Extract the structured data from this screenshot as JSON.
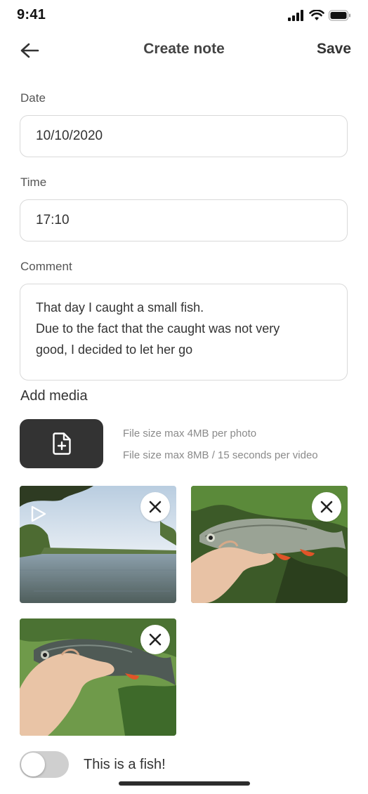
{
  "status_bar": {
    "time": "9:41"
  },
  "header": {
    "title": "Create note",
    "save_label": "Save"
  },
  "form": {
    "date": {
      "label": "Date",
      "value": "10/10/2020"
    },
    "time": {
      "label": "Time",
      "value": "17:10"
    },
    "comment": {
      "label": "Comment",
      "lines": [
        "That day I caught a small fish.",
        "Due to the fact that the caught was not very",
        "good, I decided to let her go"
      ]
    }
  },
  "media": {
    "title": "Add media",
    "hints": [
      "File size max 4MB per photo",
      "File size max 8MB / 15 seconds per video"
    ],
    "items": [
      {
        "type": "video",
        "subject": "lake"
      },
      {
        "type": "photo",
        "subject": "fish"
      },
      {
        "type": "photo",
        "subject": "fish"
      }
    ]
  },
  "toggle": {
    "label": "This is a fish!",
    "on": false
  },
  "colors": {
    "upload_button": "#333333",
    "toggle_off": "#cfcfcf",
    "border": "#d9d9d9"
  }
}
